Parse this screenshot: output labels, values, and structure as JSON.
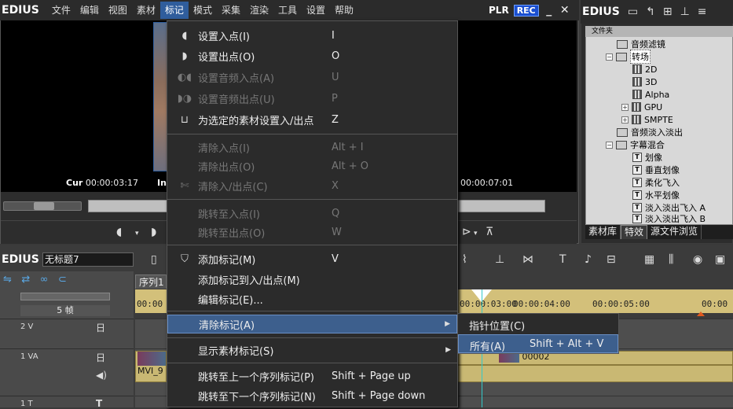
{
  "app": {
    "brand": "EDIUS"
  },
  "menubar": {
    "items": [
      "文件",
      "编辑",
      "视图",
      "素材",
      "标记",
      "模式",
      "采集",
      "渲染",
      "工具",
      "设置",
      "帮助"
    ],
    "active_index": 4,
    "plr": "PLR",
    "rec": "REC",
    "minimize": "_",
    "close": "✕"
  },
  "player": {
    "cur_label": "Cur",
    "cur_time": "00:00:03:17",
    "in_label": "In",
    "dur_time": "00:00:07:01"
  },
  "library": {
    "brand": "EDIUS",
    "tree_header": "文件夹",
    "nodes": [
      {
        "label": "音频滤镜",
        "icon": "folder"
      },
      {
        "label": "转场",
        "icon": "folder-open"
      },
      {
        "label": "2D",
        "icon": "grid"
      },
      {
        "label": "3D",
        "icon": "grid"
      },
      {
        "label": "Alpha",
        "icon": "grid"
      },
      {
        "label": "GPU",
        "icon": "grid"
      },
      {
        "label": "SMPTE",
        "icon": "grid"
      },
      {
        "label": "音频淡入淡出",
        "icon": "folder"
      },
      {
        "label": "字幕混合",
        "icon": "folder-open"
      },
      {
        "label": "划像",
        "icon": "title"
      },
      {
        "label": "垂直划像",
        "icon": "title"
      },
      {
        "label": "柔化飞入",
        "icon": "title"
      },
      {
        "label": "水平划像",
        "icon": "title"
      },
      {
        "label": "淡入淡出飞入 A",
        "icon": "title"
      },
      {
        "label": "淡入淡出飞入 B",
        "icon": "title"
      }
    ],
    "tabs": [
      "素材库",
      "特效",
      "源文件浏览"
    ],
    "active_tab": 1
  },
  "timeline": {
    "brand": "EDIUS",
    "project_name": "无标题7",
    "sequence_tab": "序列1",
    "fps_label": "5 帧",
    "ruler": [
      "00:00",
      "00:00:03:00",
      "00:00:04:00",
      "00:00:05:00",
      "00:00"
    ],
    "tracks": [
      {
        "name": "2 V"
      },
      {
        "name": "1 VA"
      },
      {
        "name": "1 T"
      }
    ],
    "clips": [
      {
        "label": "MVI_9"
      },
      {
        "label": "00002"
      }
    ]
  },
  "menu": {
    "items": [
      {
        "icon": "mark-in-icon",
        "label": "设置入点(I)",
        "key": "I",
        "enabled": true
      },
      {
        "icon": "mark-out-icon",
        "label": "设置出点(O)",
        "key": "O",
        "enabled": true
      },
      {
        "icon": "audio-in-icon",
        "label": "设置音频入点(A)",
        "key": "U",
        "enabled": false
      },
      {
        "icon": "audio-out-icon",
        "label": "设置音频出点(U)",
        "key": "P",
        "enabled": false
      },
      {
        "icon": "clip-inout-icon",
        "label": "为选定的素材设置入/出点",
        "key": "Z",
        "enabled": true
      },
      {
        "icon": "",
        "label": "清除入点(I)",
        "key": "Alt + I",
        "enabled": false
      },
      {
        "icon": "",
        "label": "清除出点(O)",
        "key": "Alt + O",
        "enabled": false
      },
      {
        "icon": "clear-inout-icon",
        "label": "清除入/出点(C)",
        "key": "X",
        "enabled": false
      },
      {
        "icon": "",
        "label": "跳转至入点(I)",
        "key": "Q",
        "enabled": false
      },
      {
        "icon": "",
        "label": "跳转至出点(O)",
        "key": "W",
        "enabled": false
      },
      {
        "icon": "add-marker-icon",
        "label": "添加标记(M)",
        "key": "V",
        "enabled": true
      },
      {
        "icon": "",
        "label": "添加标记到入/出点(M)",
        "key": "",
        "enabled": true
      },
      {
        "icon": "",
        "label": "编辑标记(E)...",
        "key": "",
        "enabled": true
      },
      {
        "icon": "",
        "label": "清除标记(A)",
        "key": "",
        "enabled": true,
        "submenu": true,
        "highlight": true
      },
      {
        "icon": "",
        "label": "显示素材标记(S)",
        "key": "",
        "enabled": true,
        "submenu": true
      },
      {
        "icon": "",
        "label": "跳转至上一个序列标记(P)",
        "key": "Shift + Page up",
        "enabled": true
      },
      {
        "icon": "",
        "label": "跳转至下一个序列标记(N)",
        "key": "Shift + Page down",
        "enabled": true
      }
    ]
  },
  "submenu": {
    "items": [
      {
        "label": "指针位置(C)",
        "key": ""
      },
      {
        "label": "所有(A)",
        "key": "Shift + Alt + V"
      }
    ]
  }
}
